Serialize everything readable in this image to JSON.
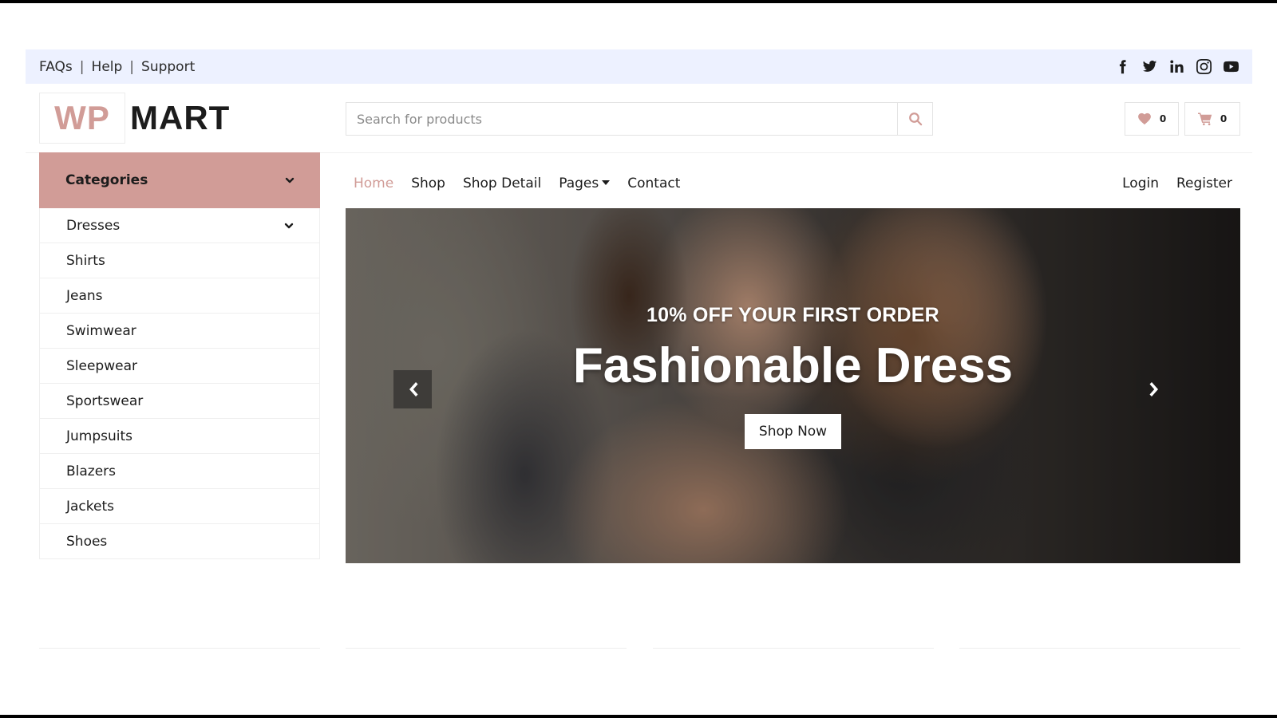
{
  "topbar": {
    "links": [
      "FAQs",
      "Help",
      "Support"
    ],
    "separator": "|",
    "social": [
      "facebook-icon",
      "twitter-icon",
      "linkedin-icon",
      "instagram-icon",
      "youtube-icon"
    ]
  },
  "logo": {
    "part1": "WP",
    "part2": "MART"
  },
  "search": {
    "placeholder": "Search for products",
    "value": ""
  },
  "header": {
    "wishlist_count": "0",
    "cart_count": "0"
  },
  "categories": {
    "title": "Categories",
    "items": [
      "Dresses",
      "Shirts",
      "Jeans",
      "Swimwear",
      "Sleepwear",
      "Sportswear",
      "Jumpsuits",
      "Blazers",
      "Jackets",
      "Shoes"
    ]
  },
  "nav": {
    "links": [
      "Home",
      "Shop",
      "Shop Detail",
      "Pages",
      "Contact"
    ],
    "login": "Login",
    "register": "Register"
  },
  "hero": {
    "subtitle": "10% OFF YOUR FIRST ORDER",
    "title": "Fashionable Dress",
    "button": "Shop Now"
  },
  "colors": {
    "accent": "#d19c97",
    "topbar_bg": "#edf1ff",
    "text": "#1c1c1c"
  }
}
